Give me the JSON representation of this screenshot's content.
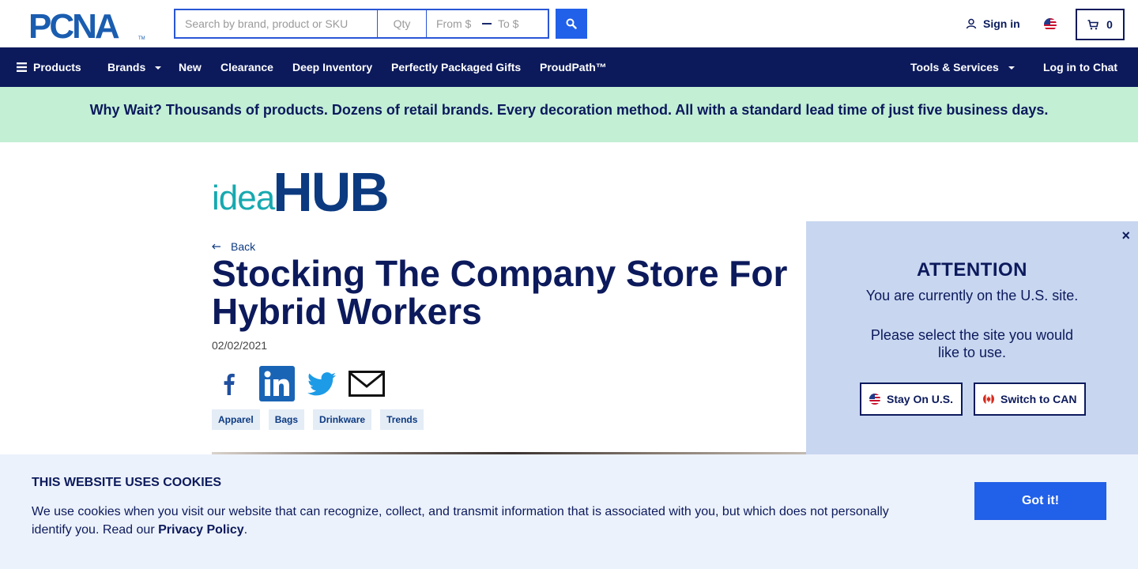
{
  "header": {
    "logo_text": "PCNA",
    "search": {
      "placeholder": "Search by brand, product or SKU",
      "value": ""
    },
    "qty": {
      "placeholder": "Qty"
    },
    "price_from": {
      "placeholder": "From $"
    },
    "price_to": {
      "placeholder": "To $"
    },
    "signin_label": "Sign in",
    "cart_count": "0"
  },
  "nav": {
    "products": "Products",
    "brands": "Brands",
    "new": "New",
    "clearance": "Clearance",
    "deep_inventory": "Deep Inventory",
    "gifts": "Perfectly Packaged Gifts",
    "proudpath": "ProudPath™",
    "tools": "Tools & Services",
    "chat": "Log in to Chat"
  },
  "promo": {
    "text": "Why Wait? Thousands of products. Dozens of retail brands. Every decoration method. All with a standard lead time of just five business days."
  },
  "ideahub": {
    "idea": "idea",
    "hub": "HUB"
  },
  "article": {
    "back_label": "Back",
    "title": "Stocking The Company Store For Hybrid Workers",
    "date": "02/02/2021",
    "tags": [
      "Apparel",
      "Bags",
      "Drinkware",
      "Trends"
    ]
  },
  "attention": {
    "close": "×",
    "title": "ATTENTION",
    "line1": "You are currently on the U.S. site.",
    "line2": "Please select the site you would like to use.",
    "stay_label": "Stay On U.S.",
    "switch_label": "Switch to CAN"
  },
  "cookie": {
    "title": "THIS WEBSITE USES COOKIES",
    "text": "We use cookies when you visit our website that can recognize, collect, and transmit information that is associated with you, but which does not personally identify you. Read our ",
    "policy_link": "Privacy Policy",
    "period": ".",
    "button": "Got it!"
  },
  "colors": {
    "navy": "#0c1a5c",
    "accent_blue": "#2160e8",
    "promo_green": "#c3efd5",
    "popup_bg": "#c8d6f0",
    "cookie_bg": "#ecf2fb",
    "teal": "#17a9b0"
  },
  "icons": [
    "search-icon",
    "user-icon",
    "us-flag-icon",
    "cart-icon",
    "menu-icon",
    "back-arrow-icon",
    "facebook-icon",
    "linkedin-icon",
    "twitter-icon",
    "email-icon",
    "close-icon",
    "canada-flag-icon"
  ]
}
